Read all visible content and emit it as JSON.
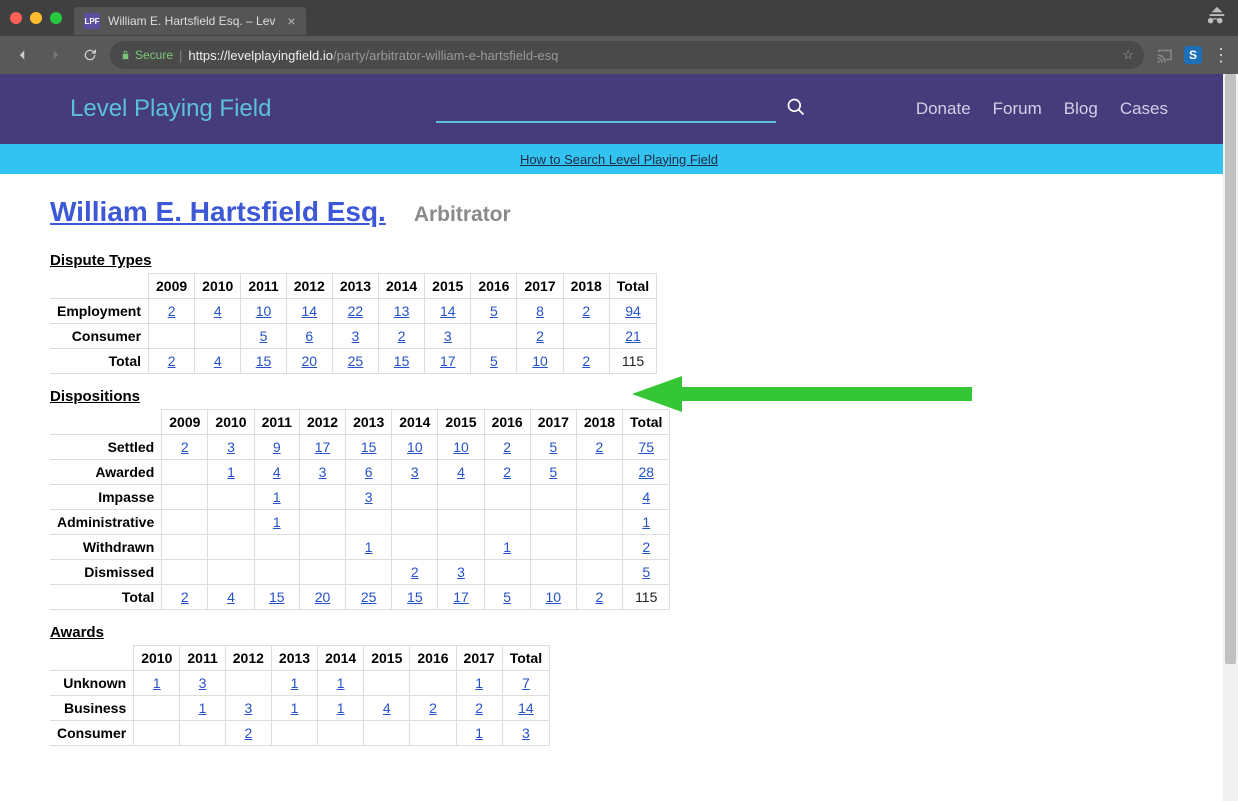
{
  "browser": {
    "tab_title": "William E. Hartsfield Esq. – Lev",
    "tab_close": "×",
    "favicon_text": "LPF",
    "secure_label": "Secure",
    "url_prefix": "https://",
    "url_host": "levelplayingfield.io",
    "url_path": "/party/arbitrator-william-e-hartsfield-esq",
    "star": "☆",
    "more": "⋮"
  },
  "site": {
    "brand": "Level Playing Field",
    "search_placeholder": "",
    "nav": {
      "donate": "Donate",
      "forum": "Forum",
      "blog": "Blog",
      "cases": "Cases"
    },
    "help_link": "How to Search Level Playing Field"
  },
  "page": {
    "title": "William E. Hartsfield Esq.",
    "role": "Arbitrator"
  },
  "tables": {
    "dispute": {
      "heading": "Dispute Types",
      "cols": [
        "2009",
        "2010",
        "2011",
        "2012",
        "2013",
        "2014",
        "2015",
        "2016",
        "2017",
        "2018",
        "Total"
      ],
      "rows": [
        {
          "label": "Employment",
          "cells": [
            "2",
            "4",
            "10",
            "14",
            "22",
            "13",
            "14",
            "5",
            "8",
            "2",
            "94"
          ]
        },
        {
          "label": "Consumer",
          "cells": [
            "",
            "",
            "5",
            "6",
            "3",
            "2",
            "3",
            "",
            "2",
            "",
            "21"
          ]
        },
        {
          "label": "Total",
          "cells": [
            "2",
            "4",
            "15",
            "20",
            "25",
            "15",
            "17",
            "5",
            "10",
            "2",
            "115"
          ],
          "is_total": true
        }
      ]
    },
    "dispositions": {
      "heading": "Dispositions",
      "cols": [
        "2009",
        "2010",
        "2011",
        "2012",
        "2013",
        "2014",
        "2015",
        "2016",
        "2017",
        "2018",
        "Total"
      ],
      "rows": [
        {
          "label": "Settled",
          "cells": [
            "2",
            "3",
            "9",
            "17",
            "15",
            "10",
            "10",
            "2",
            "5",
            "2",
            "75"
          ]
        },
        {
          "label": "Awarded",
          "cells": [
            "",
            "1",
            "4",
            "3",
            "6",
            "3",
            "4",
            "2",
            "5",
            "",
            "28"
          ]
        },
        {
          "label": "Impasse",
          "cells": [
            "",
            "",
            "1",
            "",
            "3",
            "",
            "",
            "",
            "",
            "",
            "4"
          ]
        },
        {
          "label": "Administrative",
          "cells": [
            "",
            "",
            "1",
            "",
            "",
            "",
            "",
            "",
            "",
            "",
            "1"
          ]
        },
        {
          "label": "Withdrawn",
          "cells": [
            "",
            "",
            "",
            "",
            "1",
            "",
            "",
            "1",
            "",
            "",
            "2"
          ]
        },
        {
          "label": "Dismissed",
          "cells": [
            "",
            "",
            "",
            "",
            "",
            "2",
            "3",
            "",
            "",
            "",
            "5"
          ]
        },
        {
          "label": "Total",
          "cells": [
            "2",
            "4",
            "15",
            "20",
            "25",
            "15",
            "17",
            "5",
            "10",
            "2",
            "115"
          ],
          "is_total": true
        }
      ]
    },
    "awards": {
      "heading": "Awards",
      "cols": [
        "2010",
        "2011",
        "2012",
        "2013",
        "2014",
        "2015",
        "2016",
        "2017",
        "Total"
      ],
      "rows": [
        {
          "label": "Unknown",
          "cells": [
            "1",
            "3",
            "",
            "1",
            "1",
            "",
            "",
            "1",
            "7"
          ]
        },
        {
          "label": "Business",
          "cells": [
            "",
            "1",
            "3",
            "1",
            "1",
            "4",
            "2",
            "2",
            "14"
          ]
        },
        {
          "label": "Consumer",
          "cells": [
            "",
            "",
            "2",
            "",
            "",
            "",
            "",
            "1",
            "3"
          ]
        }
      ]
    }
  }
}
